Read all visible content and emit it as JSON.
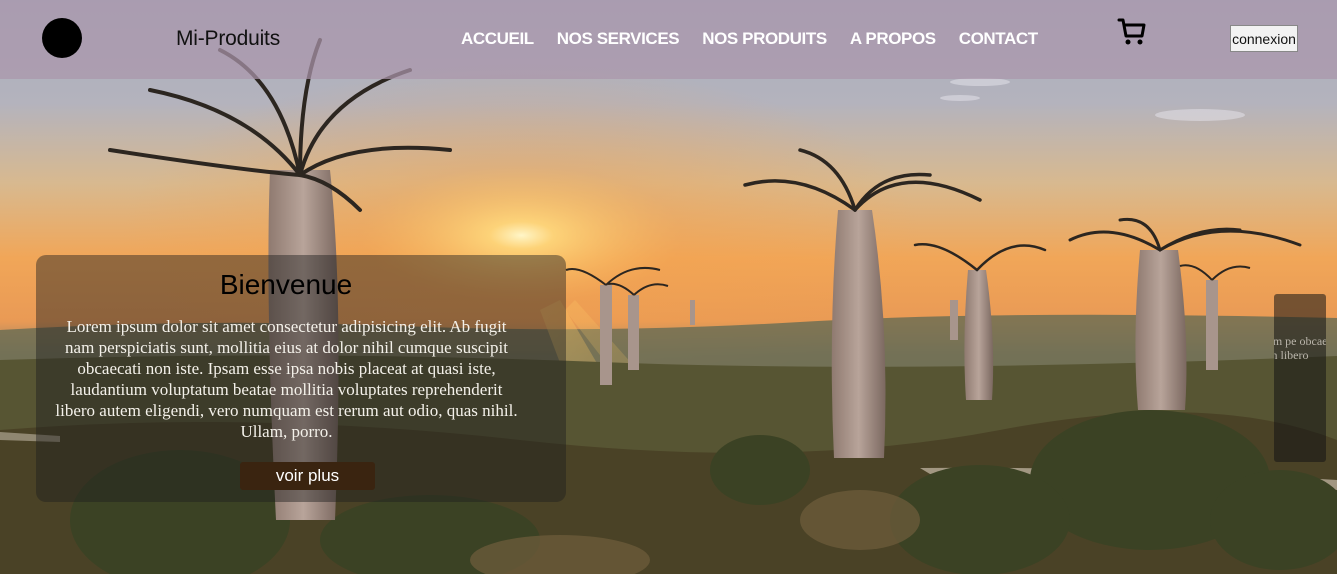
{
  "header": {
    "brand": "Mi-Produits",
    "nav": [
      "ACCUEIL",
      "NOS SERVICES",
      "NOS PRODUITS",
      "A PROPOS",
      "CONTACT"
    ],
    "login_label": "connexion",
    "cart_icon": "shopping-cart-icon"
  },
  "hero": {
    "title": "Bienvenue",
    "text": "Lorem ipsum dolor sit amet consectetur adipisicing elit. Ab fugit nam perspiciatis sunt, mollitia eius at dolor nihil cumque suscipit obcaecati non iste. Ipsam esse ipsa nobis placeat at quasi iste, laudantium voluptatum beatae mollitia voluptates reprehenderit libero autem eligendi, vero numquam est rerum aut odio, quas nihil. Ullam, porro.",
    "button_label": "voir plus"
  },
  "next_slide": {
    "text": "Lorem nam pe obcae laudan libero"
  },
  "colors": {
    "navbar_overlay": "#aa96aa",
    "card_overlay": "#1e1e1e",
    "button_bg": "#3a2410",
    "sky_top": "#9fa7b8",
    "sunset": "#f0a24a"
  }
}
